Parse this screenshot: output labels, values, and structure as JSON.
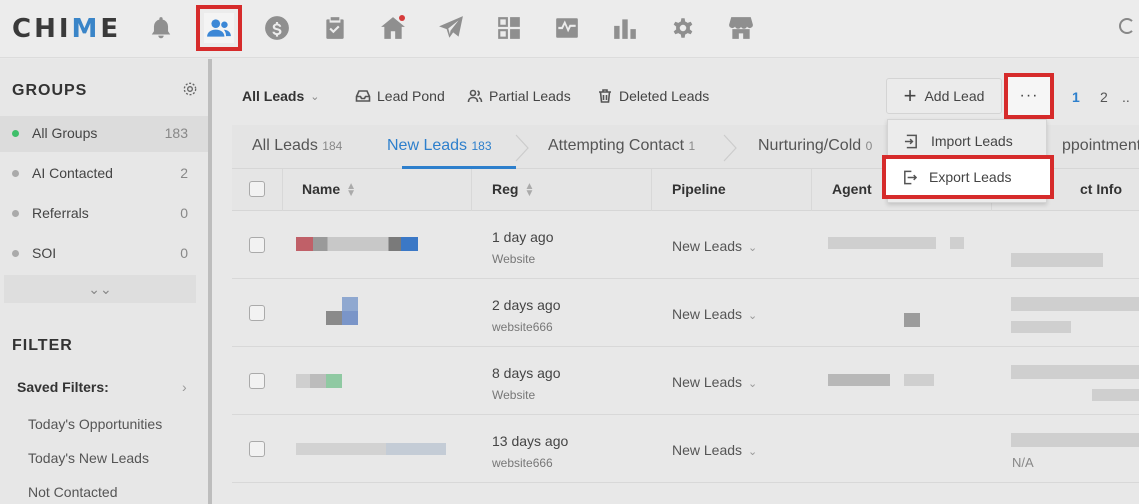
{
  "app": {
    "logo_prefix": "CHI",
    "logo_v": "M",
    "logo_suffix": "E"
  },
  "nav": {
    "items": [
      {
        "icon": "bell-icon"
      },
      {
        "icon": "people-icon",
        "active": true
      },
      {
        "icon": "dollar-icon"
      },
      {
        "icon": "clipboard-icon"
      },
      {
        "icon": "home-icon",
        "badge": true
      },
      {
        "icon": "paper-plane-icon"
      },
      {
        "icon": "dashboard-icon"
      },
      {
        "icon": "activity-icon"
      },
      {
        "icon": "bar-chart-icon"
      },
      {
        "icon": "gear-icon"
      },
      {
        "icon": "store-icon"
      }
    ]
  },
  "sidebar": {
    "groups_title": "GROUPS",
    "groups": [
      {
        "label": "All Groups",
        "count": "183"
      },
      {
        "label": "AI Contacted",
        "count": "2"
      },
      {
        "label": "Referrals",
        "count": "0"
      },
      {
        "label": "SOI",
        "count": "0"
      }
    ],
    "filter_title": "FILTER",
    "saved_filters_label": "Saved Filters:",
    "filters": [
      "Today's Opportunities",
      "Today's New Leads",
      "Not Contacted"
    ]
  },
  "toolbar": {
    "all_leads": "All Leads",
    "lead_pond": "Lead Pond",
    "partial_leads": "Partial Leads",
    "deleted_leads": "Deleted Leads",
    "add_lead": "Add Lead",
    "more": "···",
    "pages": [
      "1",
      "2",
      ".."
    ]
  },
  "tabs": [
    {
      "label": "All Leads",
      "count": "184"
    },
    {
      "label": "New Leads",
      "count": "183"
    },
    {
      "label": "Attempting Contact",
      "count": "1"
    },
    {
      "label": "Nurturing/Cold",
      "count": "0"
    },
    {
      "label": "ppointment",
      "count": ""
    }
  ],
  "table": {
    "headers": {
      "name": "Name",
      "reg": "Reg",
      "pipeline": "Pipeline",
      "agent": "Agent",
      "contact": "ct Info"
    },
    "rows": [
      {
        "reg": "1 day ago",
        "source": "Website",
        "pipeline": "New Leads"
      },
      {
        "reg": "2 days ago",
        "source": "website666",
        "pipeline": "New Leads"
      },
      {
        "reg": "8 days ago",
        "source": "Website",
        "pipeline": "New Leads"
      },
      {
        "reg": "13 days ago",
        "source": "website666",
        "pipeline": "New Leads",
        "contact_na": "N/A"
      }
    ]
  },
  "menu": {
    "import": "Import Leads",
    "export": "Export Leads"
  },
  "colors": {
    "accent": "#2d7fcc",
    "highlight": "#d62b2b",
    "active_dot": "#3fbf6a"
  }
}
